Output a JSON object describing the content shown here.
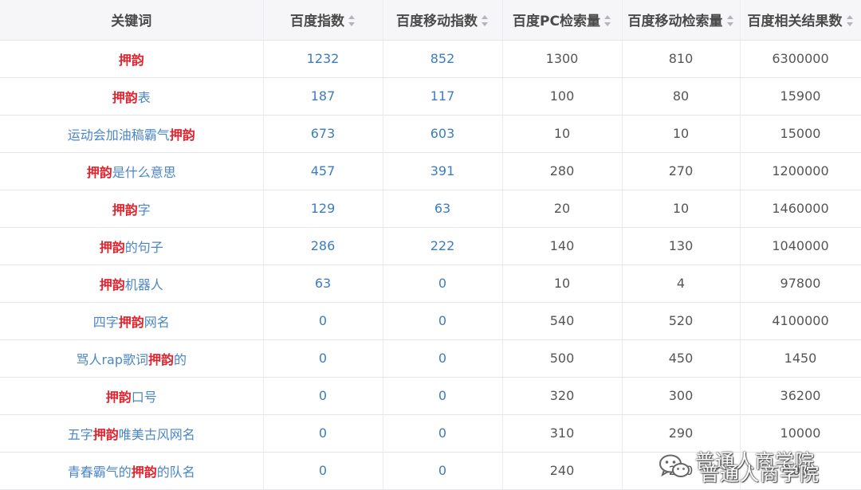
{
  "table": {
    "headers": [
      {
        "label": "关键词",
        "sortable": false
      },
      {
        "label": "百度指数",
        "sortable": true
      },
      {
        "label": "百度移动指数",
        "sortable": true
      },
      {
        "label": "百度PC检索量",
        "sortable": true
      },
      {
        "label": "百度移动检索量",
        "sortable": true
      },
      {
        "label": "百度相关结果数",
        "sortable": true
      }
    ],
    "rows": [
      {
        "kw_pre": "",
        "kw_hl": "押韵",
        "kw_post": "",
        "baidu_index": "1232",
        "mobile_index": "852",
        "pc_volume": "1300",
        "mobile_volume": "810",
        "results": "6300000"
      },
      {
        "kw_pre": "",
        "kw_hl": "押韵",
        "kw_post": "表",
        "baidu_index": "187",
        "mobile_index": "117",
        "pc_volume": "100",
        "mobile_volume": "80",
        "results": "15900"
      },
      {
        "kw_pre": "运动会加油稿霸气",
        "kw_hl": "押韵",
        "kw_post": "",
        "baidu_index": "673",
        "mobile_index": "603",
        "pc_volume": "10",
        "mobile_volume": "10",
        "results": "15000"
      },
      {
        "kw_pre": "",
        "kw_hl": "押韵",
        "kw_post": "是什么意思",
        "baidu_index": "457",
        "mobile_index": "391",
        "pc_volume": "280",
        "mobile_volume": "270",
        "results": "1200000"
      },
      {
        "kw_pre": "",
        "kw_hl": "押韵",
        "kw_post": "字",
        "baidu_index": "129",
        "mobile_index": "63",
        "pc_volume": "20",
        "mobile_volume": "10",
        "results": "1460000"
      },
      {
        "kw_pre": "",
        "kw_hl": "押韵",
        "kw_post": "的句子",
        "baidu_index": "286",
        "mobile_index": "222",
        "pc_volume": "140",
        "mobile_volume": "130",
        "results": "1040000"
      },
      {
        "kw_pre": "",
        "kw_hl": "押韵",
        "kw_post": "机器人",
        "baidu_index": "63",
        "mobile_index": "0",
        "pc_volume": "10",
        "mobile_volume": "4",
        "results": "97800"
      },
      {
        "kw_pre": "四字",
        "kw_hl": "押韵",
        "kw_post": "网名",
        "baidu_index": "0",
        "mobile_index": "0",
        "pc_volume": "540",
        "mobile_volume": "520",
        "results": "4100000"
      },
      {
        "kw_pre": "骂人rap歌词",
        "kw_hl": "押韵",
        "kw_post": "的",
        "baidu_index": "0",
        "mobile_index": "0",
        "pc_volume": "500",
        "mobile_volume": "450",
        "results": "1450"
      },
      {
        "kw_pre": "",
        "kw_hl": "押韵",
        "kw_post": "口号",
        "baidu_index": "0",
        "mobile_index": "0",
        "pc_volume": "320",
        "mobile_volume": "300",
        "results": "36200"
      },
      {
        "kw_pre": "五字",
        "kw_hl": "押韵",
        "kw_post": "唯美古风网名",
        "baidu_index": "0",
        "mobile_index": "0",
        "pc_volume": "310",
        "mobile_volume": "290",
        "results": "10000"
      },
      {
        "kw_pre": "青春霸气的",
        "kw_hl": "押韵",
        "kw_post": "的队名",
        "baidu_index": "0",
        "mobile_index": "0",
        "pc_volume": "240",
        "mobile_volume": "230",
        "results": "1080"
      }
    ]
  },
  "watermark": {
    "text": "普通人商学院",
    "icon": "wechat-icon"
  },
  "colors": {
    "highlight": "#e0232e",
    "keyword": "#4a86c5",
    "link_number": "#3b7cc2",
    "plain_number": "#555555",
    "header_bg": "#f6f6f8"
  }
}
